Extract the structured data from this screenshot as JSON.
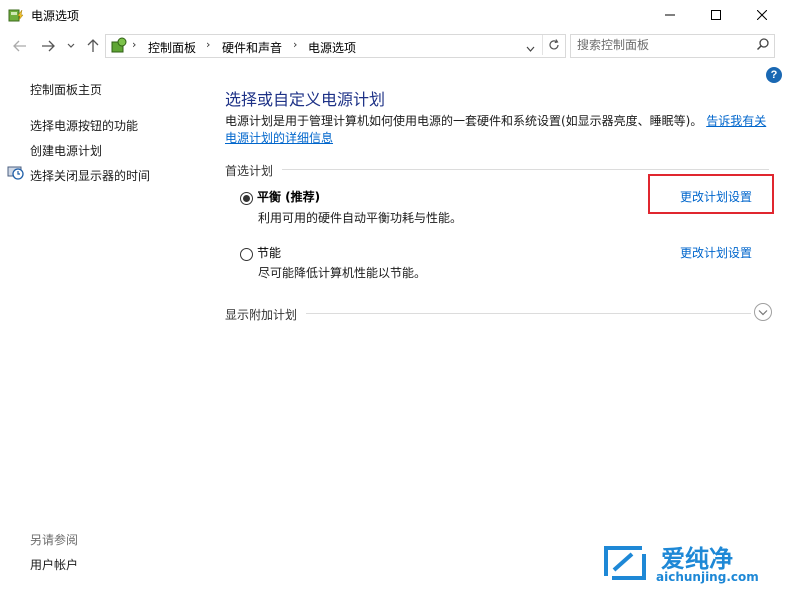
{
  "window": {
    "title": "电源选项"
  },
  "addressbar": {
    "breadcrumbs": [
      "控制面板",
      "硬件和声音",
      "电源选项"
    ],
    "search_placeholder": "搜索控制面板"
  },
  "sidebar": {
    "items": [
      {
        "label": "控制面板主页"
      },
      {
        "label": "选择电源按钮的功能"
      },
      {
        "label": "创建电源计划"
      },
      {
        "label": "选择关闭显示器的时间"
      }
    ],
    "see_also_label": "另请参阅",
    "see_also_items": [
      {
        "label": "用户帐户"
      }
    ]
  },
  "main": {
    "title": "选择或自定义电源计划",
    "description": "电源计划是用于管理计算机如何使用电源的一套硬件和系统设置(如显示器亮度、睡眠等)。",
    "description_link": "告诉我有关电源计划的详细信息",
    "preferred_label": "首选计划",
    "plans": [
      {
        "name": "平衡 (推荐)",
        "desc": "利用可用的硬件自动平衡功耗与性能。",
        "link": "更改计划设置",
        "selected": true
      },
      {
        "name": "节能",
        "desc": "尽可能降低计算机性能以节能。",
        "link": "更改计划设置",
        "selected": false
      }
    ],
    "show_more_label": "显示附加计划"
  },
  "watermark": {
    "text": "爱纯净",
    "url": "aichunjing.com"
  },
  "colors": {
    "link": "#0066cc",
    "title": "#1e3287",
    "highlight": "#e0262f",
    "watermark": "#1e88d6"
  }
}
